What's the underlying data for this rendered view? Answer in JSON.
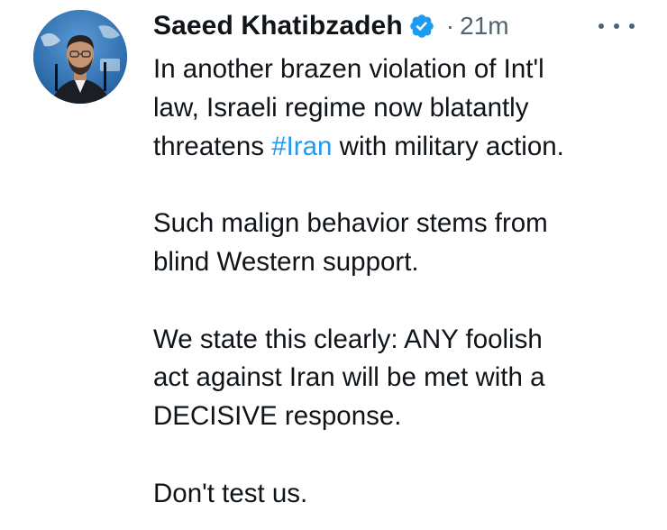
{
  "tweet": {
    "author_name": "Saeed Khatibzadeh",
    "separator": "·",
    "time": "21m",
    "verified": true,
    "colors": {
      "text": "#0f1419",
      "secondary": "#536471",
      "hashtag": "#1d9bf0",
      "verified": "#1d9bf0"
    },
    "icons": {
      "verified": "verified-badge-icon",
      "more": "more-options-icon"
    },
    "body": {
      "p1_line1": "In another brazen violation of Int'l",
      "p1_line2": "law, Israeli regime now blatantly",
      "p1_line3_pre": "threatens ",
      "p1_hashtag": "#Iran",
      "p1_line3_post": " with military action.",
      "p2_line1": "Such malign behavior stems from",
      "p2_line2": "blind Western support.",
      "p3_line1": "We state this clearly: ANY foolish",
      "p3_line2": "act against Iran will be met with a",
      "p3_line3": "DECISIVE response.",
      "p4_line1": "Don't test us."
    }
  }
}
